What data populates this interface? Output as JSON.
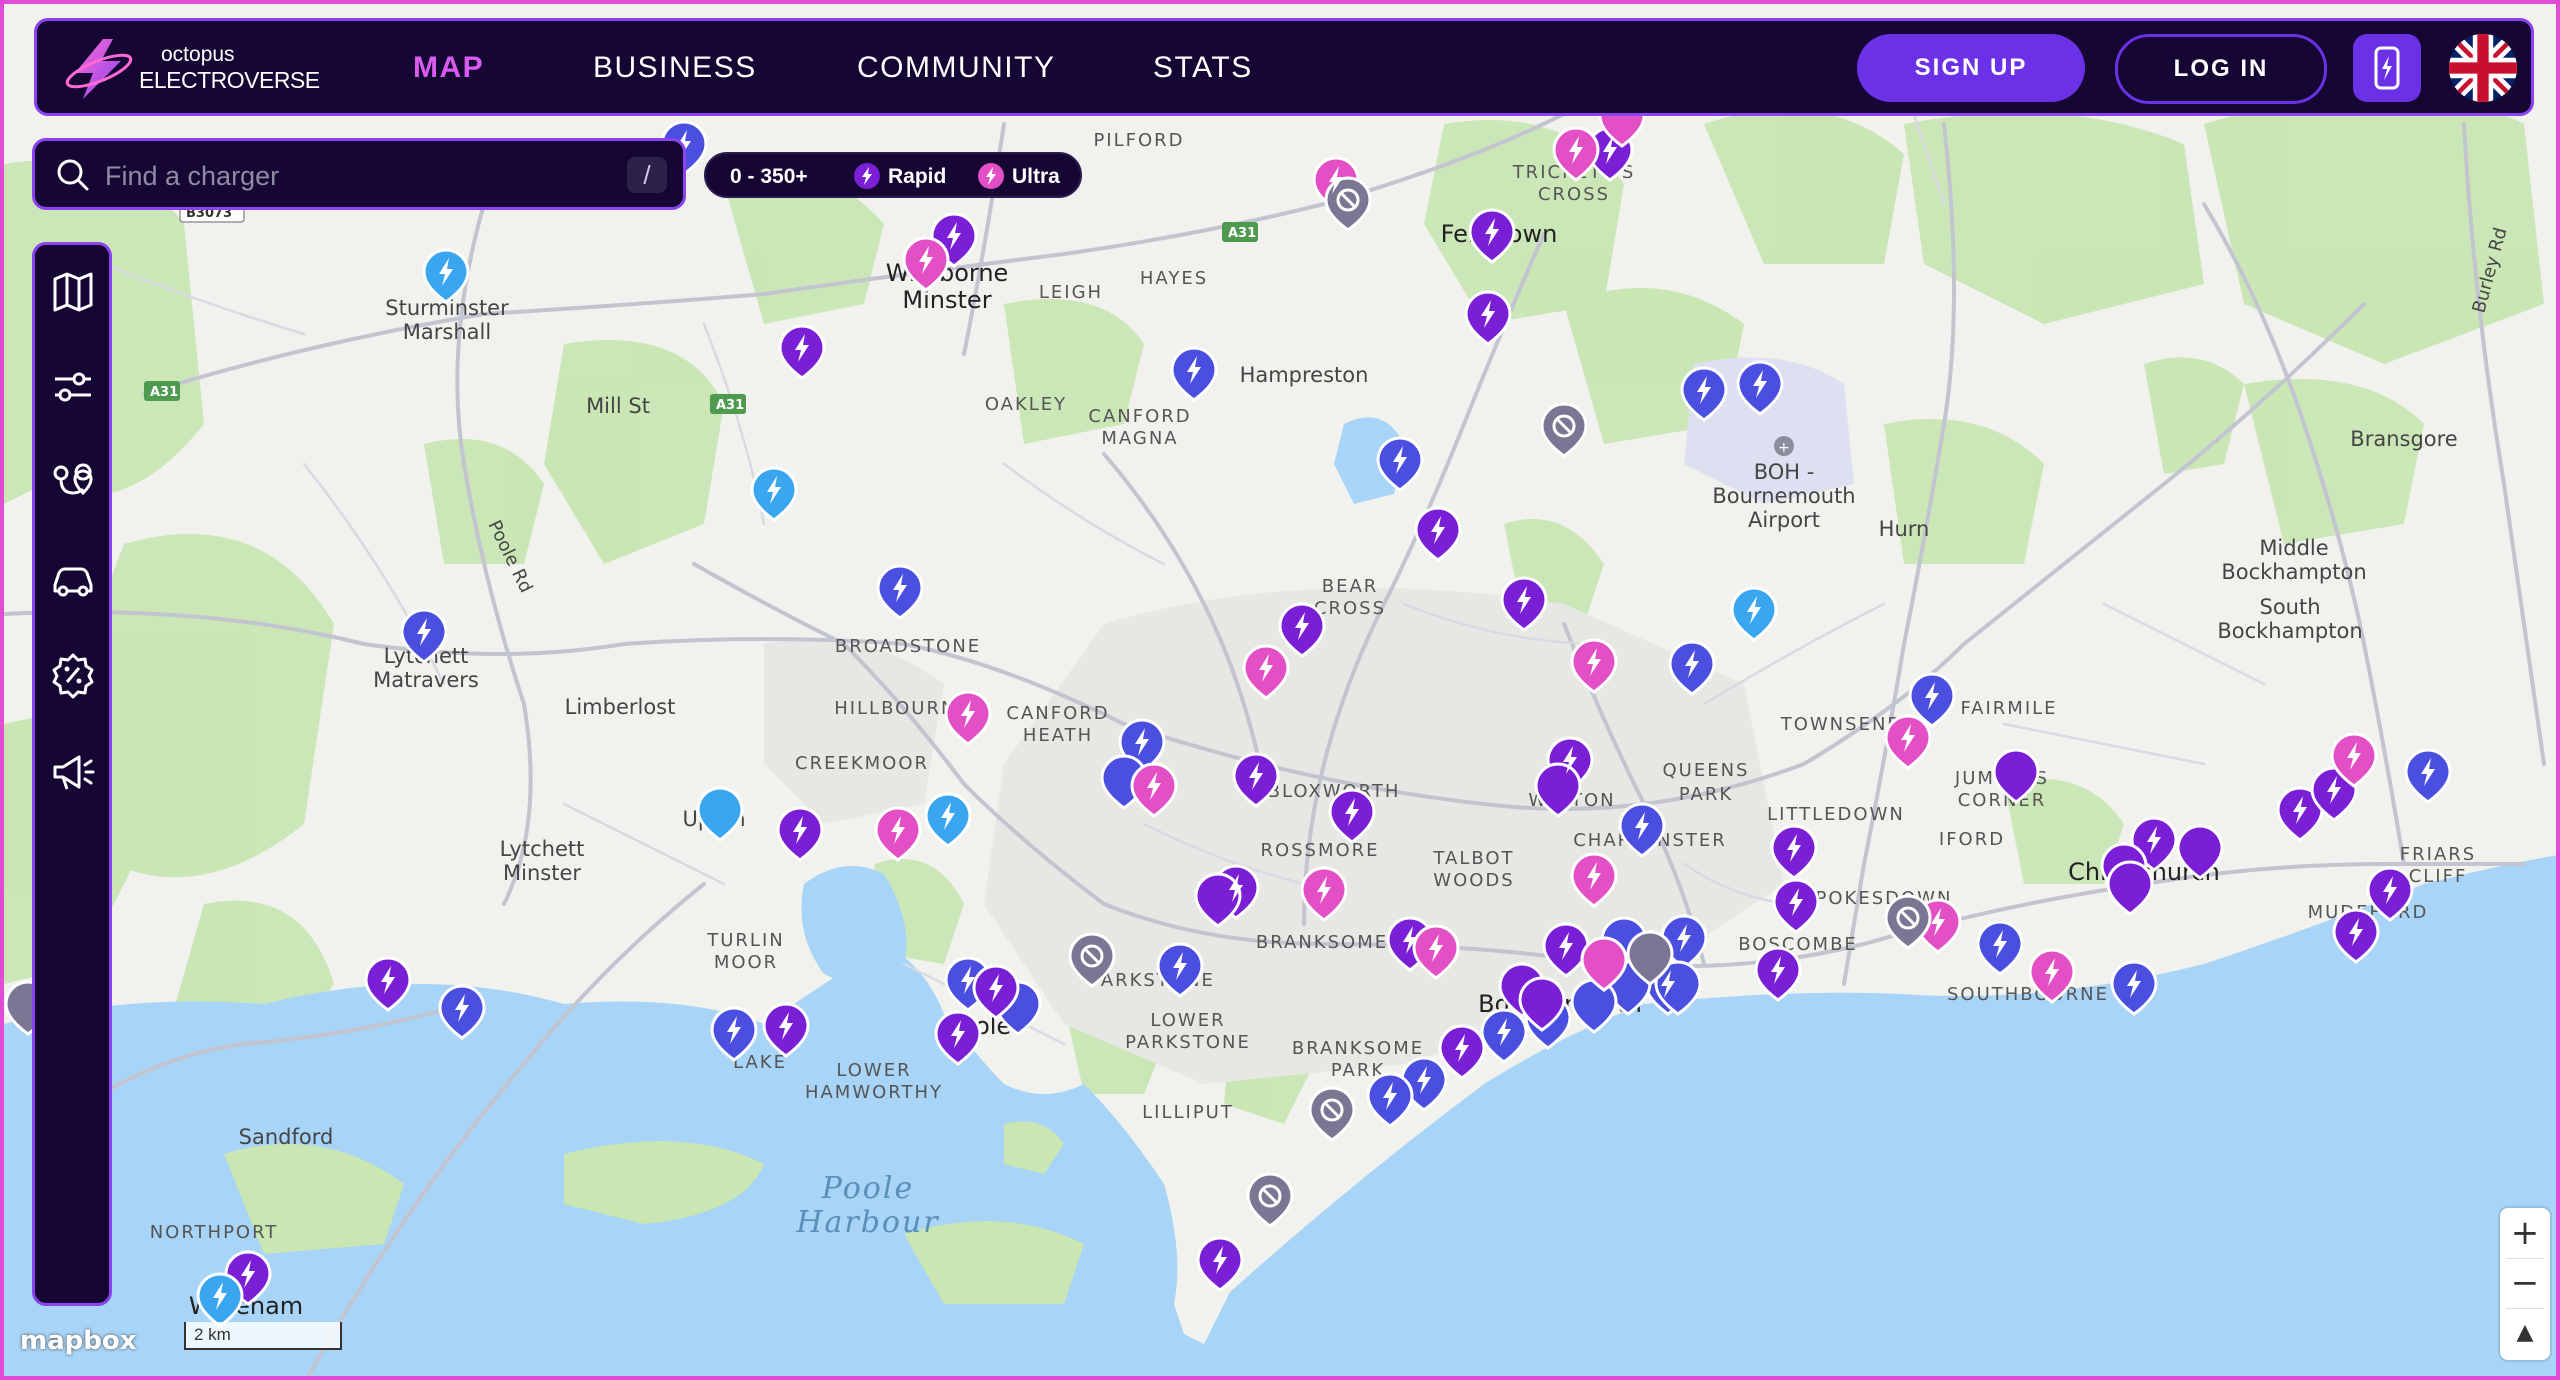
{
  "nav": {
    "logo_line1": "octopus",
    "logo_line2": "ELECTROVERSE",
    "links": [
      "MAP",
      "BUSINESS",
      "COMMUNITY",
      "STATS"
    ],
    "signup": "SIGN UP",
    "login": "LOG IN",
    "language_flag": "uk-flag-icon"
  },
  "search": {
    "placeholder": "Find a charger",
    "shortcut": "/"
  },
  "filter": {
    "range": "0 - 350+",
    "rapid": "Rapid",
    "ultra": "Ultra"
  },
  "sidebar": {
    "icons": [
      "map-icon",
      "sliders-icon",
      "route-planner-icon",
      "car-icon",
      "badge-percent-icon",
      "megaphone-icon"
    ]
  },
  "zoom": {
    "in": "+",
    "out": "−",
    "compass": "▲"
  },
  "attribution": {
    "mapbox": "mapbox",
    "scale": "2 km"
  },
  "colors": {
    "nav_bg": "#150633",
    "accent_purple": "#6b31e6",
    "active_pink": "#d75bef",
    "marker_blue": "#4a4fe0",
    "marker_purple": "#7a1fd6",
    "marker_pink": "#e34fc4",
    "marker_cyan": "#3aa6ef",
    "marker_grey": "#7b7693",
    "water": "#a8d4f7",
    "land": "#f1f1ee",
    "park": "#c9e6b3"
  },
  "map": {
    "places": [
      "Sturminster Marshall",
      "Wimborne Minster",
      "Leigh",
      "Hayes",
      "Pilford",
      "Trickett's Cross",
      "Ferndown",
      "Hampreston",
      "Oakley",
      "Canford Magna",
      "Mill St",
      "Poole Rd",
      "Lytchett Matravers",
      "Limberlost",
      "Broadstone",
      "Hillbourne",
      "Canford Heath",
      "Creekmoor",
      "Upton",
      "Lytchett Minster",
      "Bear Cross",
      "Bloxworth",
      "Rossmore",
      "Talbot Woods",
      "Winton",
      "Charminster",
      "Queens Park",
      "Turlin Moor",
      "Lake",
      "Poole",
      "Parkstone",
      "Lower Parkstone",
      "Branksome",
      "Lower Hamworthy",
      "Lilliput",
      "Branksome Park",
      "Bournemouth",
      "Boscombe",
      "Pokesdown",
      "Southbourne",
      "Littledown",
      "Iford",
      "Townsend",
      "Fairmile",
      "Jumpers Corner",
      "Christchurch",
      "Mudeford",
      "Friars Cliff",
      "Hurn",
      "BOH - Bournemouth Airport",
      "Bransgore",
      "Middle Bockhampton",
      "South Bockhampton",
      "Burley Rd",
      "Sandford",
      "Northport",
      "Wareham",
      "Poole Harbour",
      "A31",
      "B3073"
    ]
  }
}
